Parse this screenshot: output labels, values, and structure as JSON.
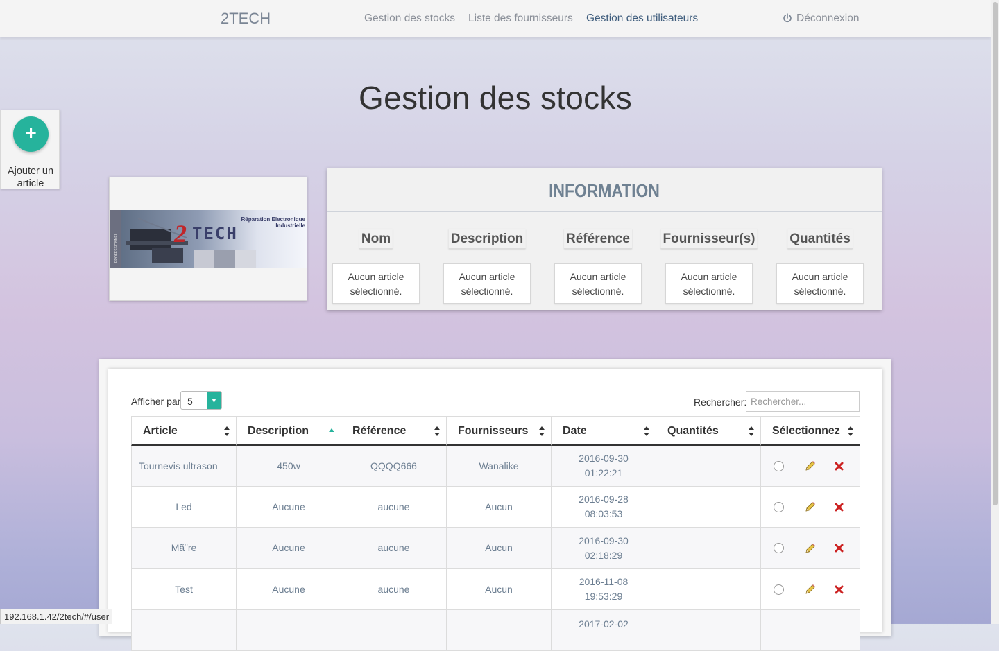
{
  "nav": {
    "brand": "2TECH",
    "links": [
      {
        "label": "Gestion des stocks"
      },
      {
        "label": "Liste des fournisseurs"
      },
      {
        "label": "Gestion des utilisateurs"
      }
    ],
    "active_link": "Gestion des utilisateurs",
    "logout_label": "Déconnexion",
    "logout_icon": "power-icon"
  },
  "add_article": {
    "icon": "plus-icon",
    "label_line1": "Ajouter un",
    "label_line2": "article",
    "accent_color": "#26b39c"
  },
  "page": {
    "title": "Gestion des stocks"
  },
  "logo": {
    "text": "2TECH",
    "tagline_line1": "Réparation Electronique",
    "tagline_line2": "Industrielle",
    "side_text": "PROFESSIONNEL"
  },
  "information": {
    "title": "INFORMATION",
    "columns": [
      {
        "label": "Nom",
        "value_line1": "Aucun article",
        "value_line2": "sélectionné."
      },
      {
        "label": "Description",
        "value_line1": "Aucun article",
        "value_line2": "sélectionné."
      },
      {
        "label": "Référence",
        "value_line1": "Aucun article",
        "value_line2": "sélectionné."
      },
      {
        "label": "Fournisseur(s)",
        "value_line1": "Aucun article",
        "value_line2": "sélectionné."
      },
      {
        "label": "Quantités",
        "value_line1": "Aucun article",
        "value_line2": "sélectionné."
      }
    ]
  },
  "table": {
    "per_page_label": "Afficher par",
    "per_page_value": "5",
    "search_label": "Rechercher:",
    "search_placeholder": "Rechercher...",
    "headers": [
      "Article",
      "Description",
      "Référence",
      "Fournisseurs",
      "Date",
      "Quantités",
      "Sélectionnez"
    ],
    "sorted_column": "Description",
    "sort_direction": "asc",
    "rows": [
      {
        "article": "Tournevis ultrason",
        "description": "450w",
        "reference": "QQQQ666",
        "fournisseurs": "Wanalike",
        "date": "2016-09-30",
        "time": "01:22:21",
        "quantites": ""
      },
      {
        "article": "Led",
        "description": "Aucune",
        "reference": "aucune",
        "fournisseurs": "Aucun",
        "date": "2016-09-28",
        "time": "08:03:53",
        "quantites": ""
      },
      {
        "article": "Mã¨re",
        "description": "Aucune",
        "reference": "aucune",
        "fournisseurs": "Aucun",
        "date": "2016-09-30",
        "time": "02:18:29",
        "quantites": ""
      },
      {
        "article": "Test",
        "description": "Aucune",
        "reference": "aucune",
        "fournisseurs": "Aucun",
        "date": "2016-11-08",
        "time": "19:53:29",
        "quantites": ""
      },
      {
        "article": "",
        "description": "",
        "reference": "",
        "fournisseurs": "",
        "date": "2017-02-02",
        "time": "",
        "quantites": ""
      }
    ],
    "row_icons": [
      "radio-icon",
      "pencil-icon",
      "delete-x-icon"
    ],
    "delete_color": "#cc2222"
  },
  "status_bar": {
    "url": "192.168.1.42/2tech/#/user"
  }
}
